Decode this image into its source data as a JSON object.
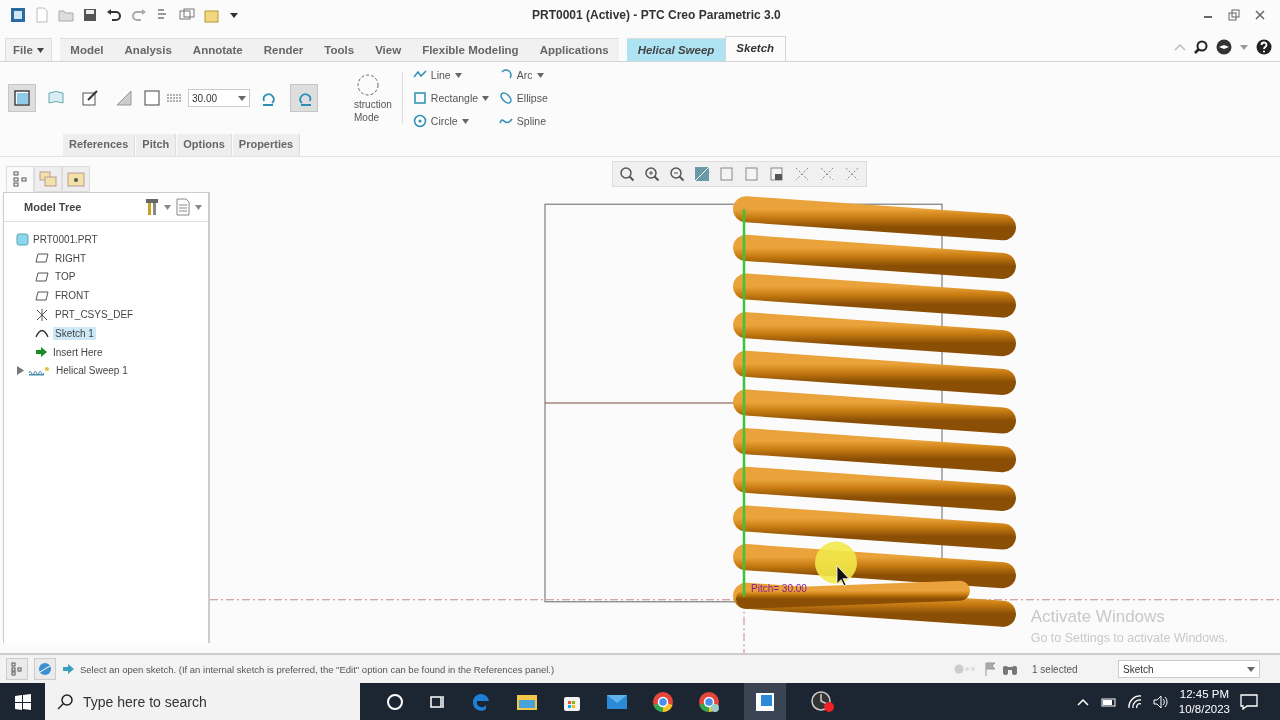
{
  "window": {
    "title": "PRT0001 (Active) - PTC Creo Parametric 3.0"
  },
  "ribbon_tabs": [
    {
      "label": "File",
      "kind": "menu",
      "selected": false
    },
    {
      "label": "Model",
      "kind": "plain",
      "selected": false
    },
    {
      "label": "Analysis",
      "kind": "plain",
      "selected": false
    },
    {
      "label": "Annotate",
      "kind": "plain",
      "selected": false
    },
    {
      "label": "Render",
      "kind": "plain",
      "selected": false
    },
    {
      "label": "Tools",
      "kind": "plain",
      "selected": false
    },
    {
      "label": "View",
      "kind": "plain",
      "selected": false
    },
    {
      "label": "Flexible Modeling",
      "kind": "plain",
      "selected": false
    },
    {
      "label": "Applications",
      "kind": "plain",
      "selected": false
    },
    {
      "label": "Helical Sweep",
      "kind": "contextual",
      "selected": false
    },
    {
      "label": "Sketch",
      "kind": "contextual",
      "selected": true
    }
  ],
  "dashboard": {
    "toggles": [
      {
        "kind": "solid",
        "on": true
      },
      {
        "kind": "surface",
        "on": false
      },
      {
        "kind": "edit",
        "on": false
      },
      {
        "kind": "remove",
        "on": false
      }
    ],
    "pitch_value": "30.00",
    "handedness": [
      {
        "kind": "left",
        "on": false
      },
      {
        "kind": "right",
        "on": true
      }
    ],
    "construction_mode": [
      "struction",
      "Mode"
    ],
    "sketch_tools": [
      {
        "label": "Line",
        "kind": "line",
        "menu": true
      },
      {
        "label": "Rectangle",
        "kind": "rectangle",
        "menu": true
      },
      {
        "label": "Circle",
        "kind": "circle",
        "menu": true
      },
      {
        "label": "Arc",
        "kind": "arc",
        "menu": true
      },
      {
        "label": "Ellipse",
        "kind": "ellipse",
        "menu": false
      },
      {
        "label": "Spline",
        "kind": "spline",
        "menu": false
      }
    ],
    "panel_tabs": [
      "References",
      "Pitch",
      "Options",
      "Properties"
    ]
  },
  "model_tree": {
    "title": "Model Tree",
    "root": "PRT0001.PRT",
    "items": [
      {
        "label": "RIGHT",
        "kind": "plane",
        "selected": false
      },
      {
        "label": "TOP",
        "kind": "plane",
        "selected": false
      },
      {
        "label": "FRONT",
        "kind": "plane",
        "selected": false
      },
      {
        "label": "PRT_CSYS_DEF",
        "kind": "csys",
        "selected": false
      },
      {
        "label": "Sketch 1",
        "kind": "sketch",
        "selected": true
      },
      {
        "label": "Insert Here",
        "kind": "insert",
        "selected": false
      },
      {
        "label": "Helical Sweep 1",
        "kind": "sweep",
        "selected": false,
        "expanded": false
      }
    ]
  },
  "graphics": {
    "pitch_label": "Pitch= 30.00"
  },
  "activation_notice": {
    "title": "Activate Windows",
    "text": "Go to Settings to activate Windows."
  },
  "status_bar": {
    "message": "Select an open sketch. (If an internal sketch is preferred, the \"Edit\" option can be found in the References panel.)",
    "selection": "1 selected",
    "filter": "Sketch"
  },
  "taskbar": {
    "search_placeholder": "Type here to search",
    "time": "12:45 PM",
    "date": "10/8/2023"
  }
}
